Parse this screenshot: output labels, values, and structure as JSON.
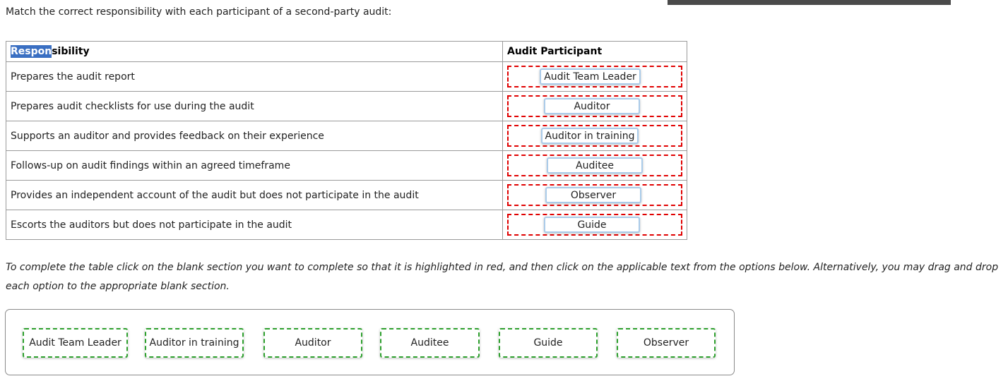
{
  "question": {
    "prompt": "Match the correct responsibility with each participant of a second-party audit:"
  },
  "table": {
    "headers": {
      "responsibility_selected": "Respon",
      "responsibility_rest": "sibility",
      "participant": "Audit Participant"
    },
    "rows": [
      {
        "responsibility": "Prepares the audit report",
        "answer": "Audit Team Leader"
      },
      {
        "responsibility": "Prepares audit checklists for use during the audit",
        "answer": "Auditor"
      },
      {
        "responsibility": "Supports an auditor and provides feedback on their experience",
        "answer": "Auditor in training"
      },
      {
        "responsibility": "Follows-up on audit findings within an agreed timeframe",
        "answer": "Auditee"
      },
      {
        "responsibility": "Provides an independent account of the audit but does not participate in the audit",
        "answer": "Observer"
      },
      {
        "responsibility": "Escorts the auditors but does not participate in the audit",
        "answer": "Guide"
      }
    ]
  },
  "instructions": "To complete the table click on the blank section you want to complete so that it is highlighted in red, and then click on the applicable text from the options below. Alternatively, you may drag and drop each option to the appropriate blank section.",
  "options": [
    "Audit Team Leader",
    "Auditor in training",
    "Auditor",
    "Auditee",
    "Guide",
    "Observer"
  ],
  "colors": {
    "blank_border": "#e00000",
    "option_border": "#2ea02e",
    "chip_border": "#aacbe9",
    "selection_highlight": "#3a6fc2"
  }
}
